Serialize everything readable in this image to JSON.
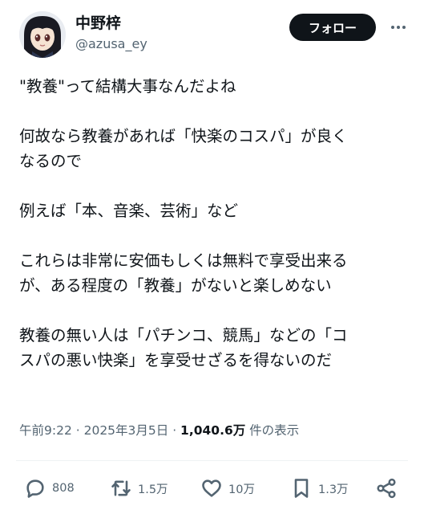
{
  "user": {
    "display_name": "中野梓",
    "handle": "@azusa_ey"
  },
  "header": {
    "follow_label": "フォロー",
    "more_icon": "more-horizontal-icon"
  },
  "post": {
    "paragraphs": [
      "\"教養\"って結構大事なんだよね",
      "何故なら教養があれば「快楽のコスパ」が良く\nなるので",
      "例えば「本、音楽、芸術」など",
      "これらは非常に安価もしくは無料で享受出来る\nが、ある程度の「教養」がないと楽しめない",
      "教養の無い人は「パチンコ、競馬」などの「コ\nスパの悪い快楽」を享受せざるを得ないのだ"
    ]
  },
  "meta": {
    "time": "午前9:22",
    "separator1": " · ",
    "date": "2025年3月5日",
    "separator2": " · ",
    "views_count": "1,040.6万",
    "views_label": " 件の表示"
  },
  "actions": {
    "replies": "808",
    "reposts": "1.5万",
    "likes": "10万",
    "bookmarks": "1.3万"
  },
  "colors": {
    "text": "#0f1419",
    "secondary": "#536471",
    "follow_button": "#0f1419"
  }
}
